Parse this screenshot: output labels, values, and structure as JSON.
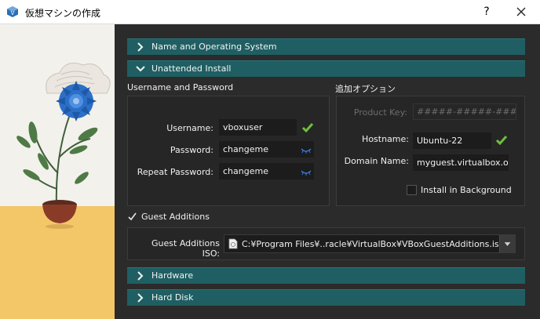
{
  "window": {
    "title": "仮想マシンの作成",
    "help_label": "?",
    "close_label": "×"
  },
  "sections": {
    "name_os": "Name and Operating System",
    "unattended": "Unattended Install",
    "hardware": "Hardware",
    "hard_disk": "Hard Disk"
  },
  "credentials": {
    "group_title": "Username and Password",
    "username_label": "Username:",
    "username_value": "vboxuser",
    "password_label": "Password:",
    "password_value": "changeme",
    "repeat_label": "Repeat Password:",
    "repeat_value": "changeme"
  },
  "options": {
    "group_title": "追加オプション",
    "product_key_label": "Product Key:",
    "product_key_value": "#####-#####-#####-#####",
    "hostname_label": "Hostname:",
    "hostname_value": "Ubuntu-22",
    "domain_label": "Domain Name:",
    "domain_value": "myguest.virtualbox.org",
    "install_bg_label": "Install in Background"
  },
  "guest_additions": {
    "checkbox_label": "Guest Additions",
    "iso_label": "Guest Additions ISO:",
    "iso_value": "C:¥Program Files¥..racle¥VirtualBox¥VBoxGuestAdditions.iso"
  },
  "colors": {
    "section_bar": "#1f5f63",
    "check_ok": "#6cc13c",
    "eye": "#3a78d8",
    "background": "#2b2b2b"
  }
}
